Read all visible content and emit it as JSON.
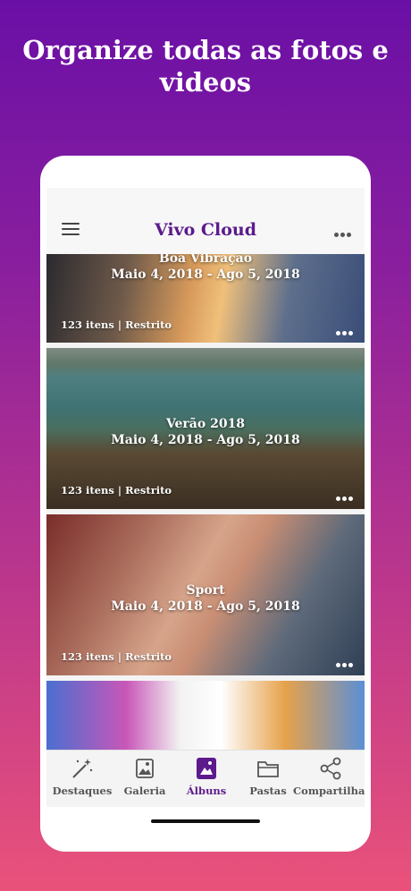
{
  "headline": "Organize todas as fotos e videos",
  "app": {
    "title": "Vivo Cloud"
  },
  "albums": [
    {
      "title": "Boa Vibração",
      "dates": "Maio 4, 2018 - Ago 5, 2018",
      "meta": "123 itens | Restrito"
    },
    {
      "title": "Verão 2018",
      "dates": "Maio 4, 2018 - Ago 5, 2018",
      "meta": "123 itens | Restrito"
    },
    {
      "title": "Sport",
      "dates": "Maio 4, 2018 - Ago 5, 2018",
      "meta": "123 itens | Restrito"
    }
  ],
  "tabs": [
    {
      "label": "Destaques",
      "icon": "magic-wand-icon"
    },
    {
      "label": "Galeria",
      "icon": "gallery-icon"
    },
    {
      "label": "Álbuns",
      "icon": "album-icon",
      "active": true
    },
    {
      "label": "Pastas",
      "icon": "folder-icon"
    },
    {
      "label": "Compartilhar",
      "icon": "share-icon"
    }
  ],
  "colors": {
    "brand": "#5c1a8c",
    "gradient_top": "#6a0fa6",
    "gradient_bottom": "#e9527a"
  }
}
